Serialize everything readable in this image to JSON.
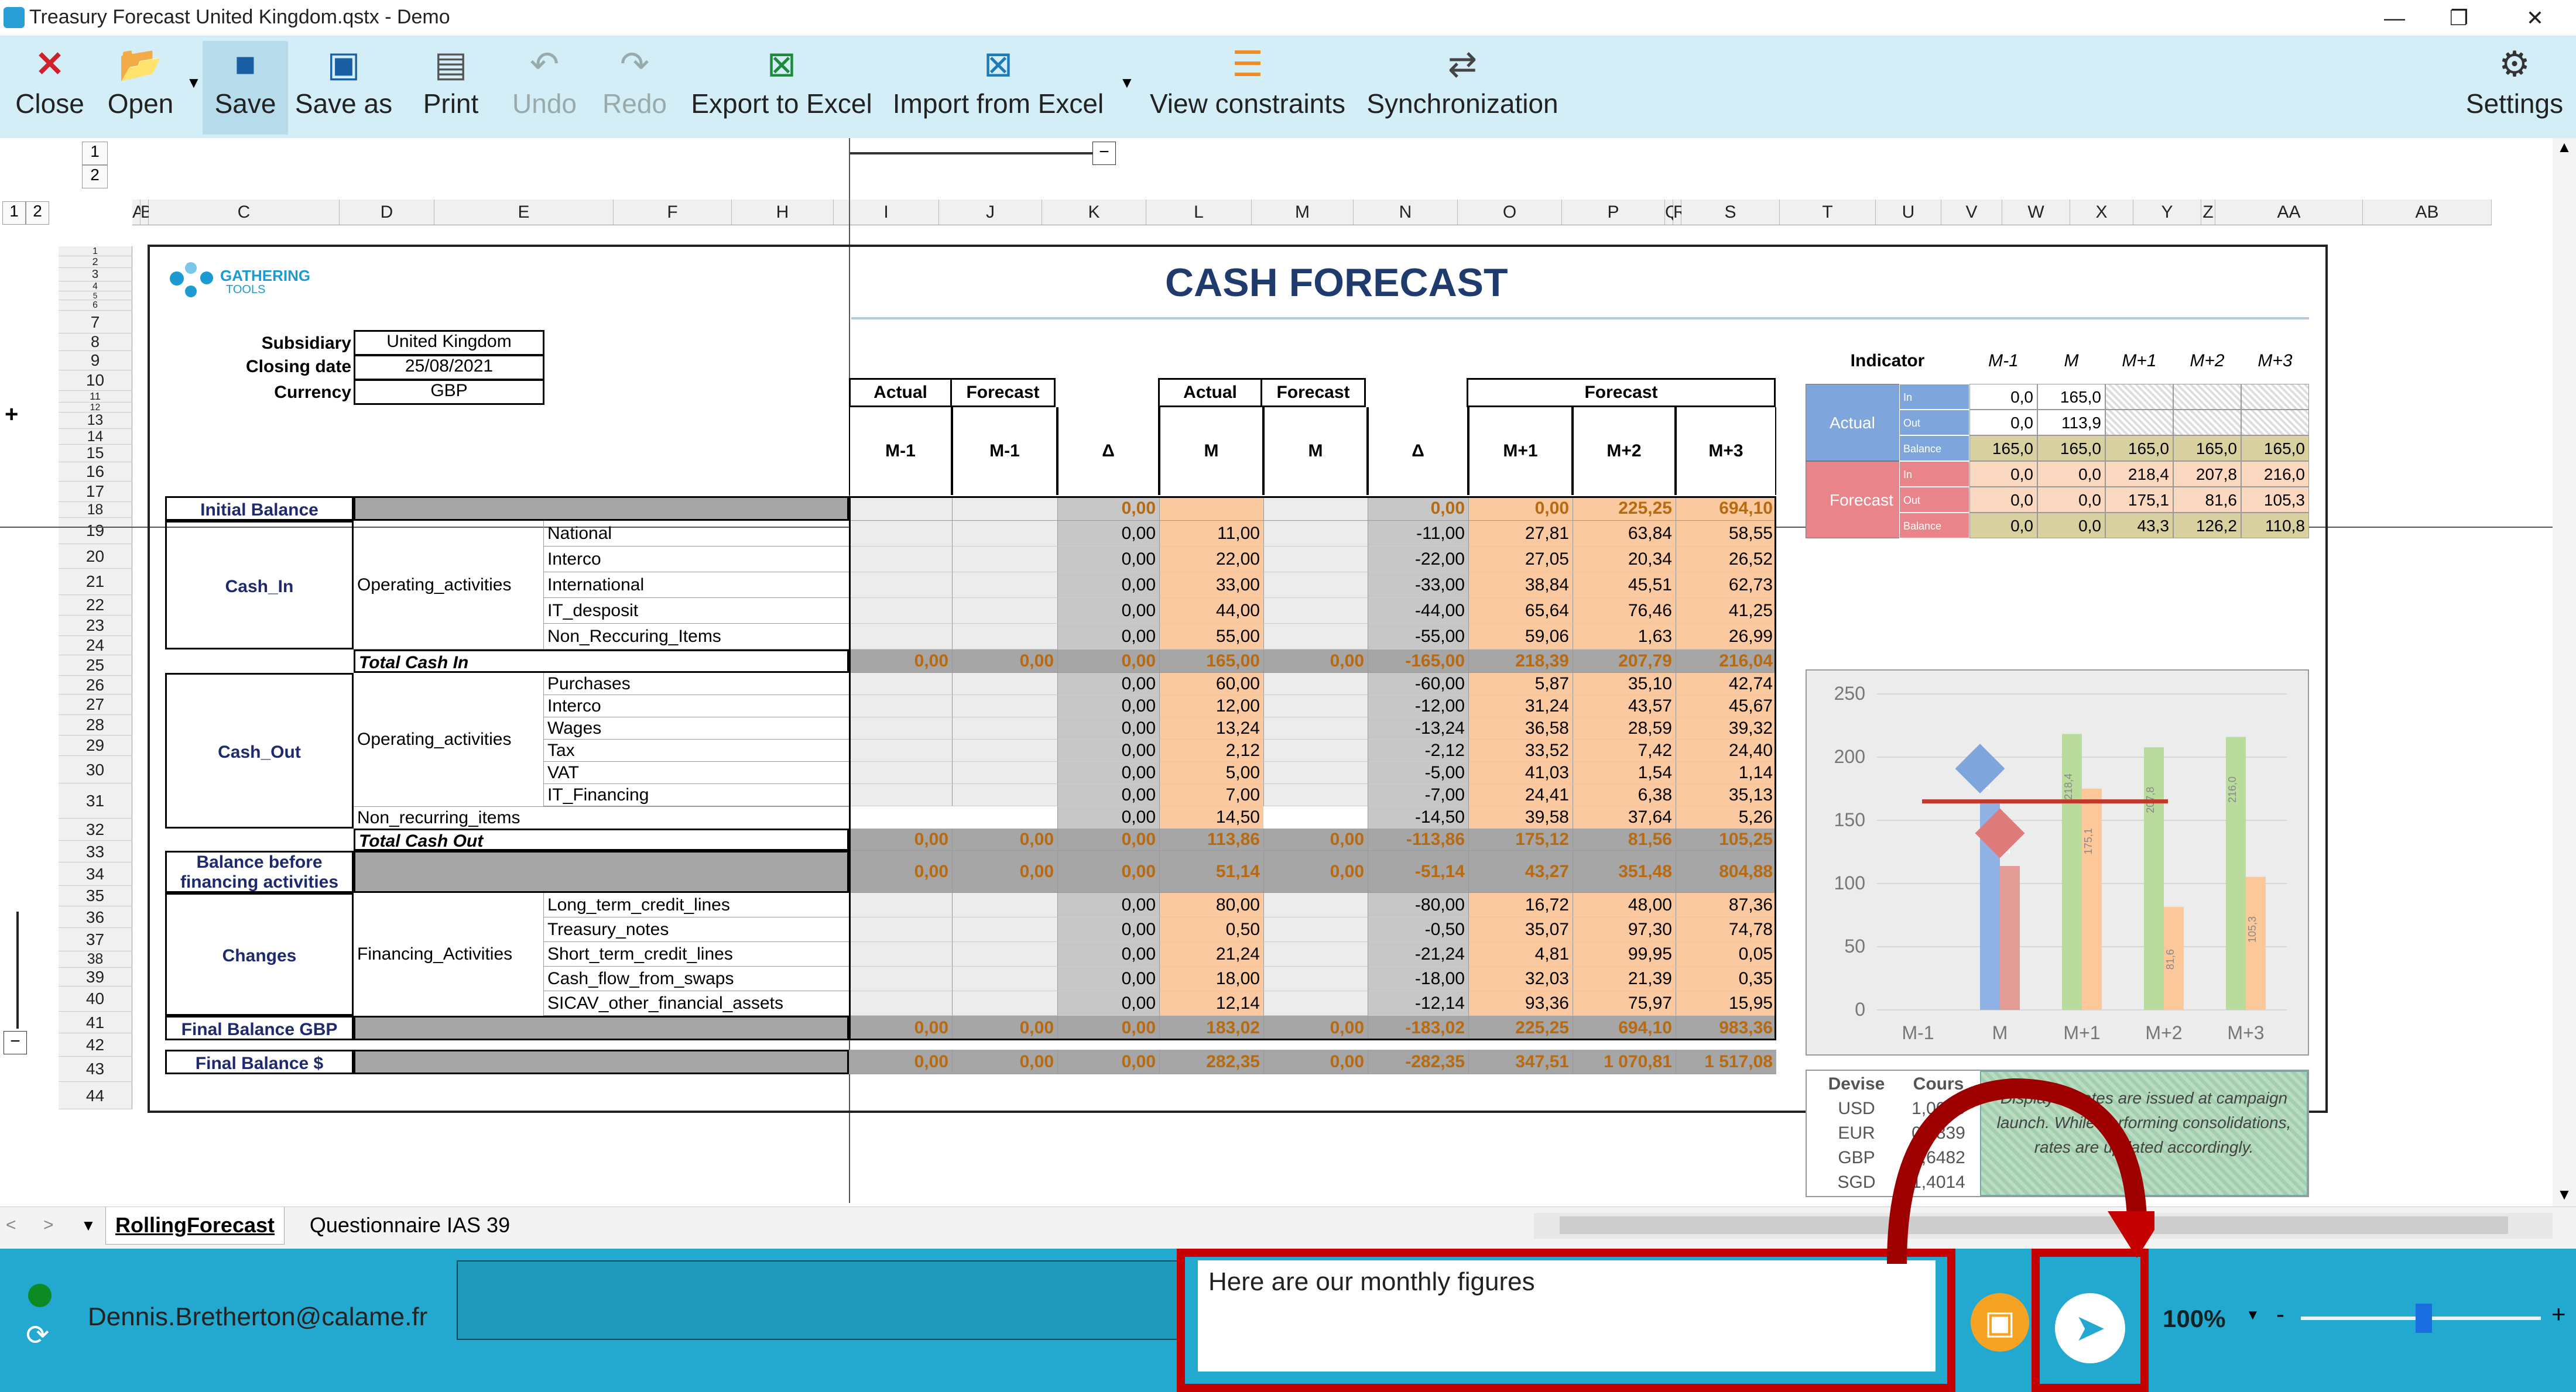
{
  "window": {
    "title": "Treasury Forecast United Kingdom.qstx - Demo",
    "minimize": "—",
    "restore": "❐",
    "close": "✕"
  },
  "toolbar": {
    "close": "Close",
    "open": "Open",
    "save": "Save",
    "save_as": "Save as",
    "print": "Print",
    "undo": "Undo",
    "redo": "Redo",
    "export_excel": "Export to Excel",
    "import_excel": "Import from Excel",
    "view_constraints": "View constraints",
    "synchronization": "Synchronization",
    "settings": "Settings"
  },
  "outline": {
    "levels": [
      "1",
      "2"
    ],
    "row_levels": [
      "1",
      "2"
    ],
    "expand": "+",
    "collapse": "−"
  },
  "columns": [
    "A",
    "B",
    "C",
    "D",
    "E",
    "F",
    "H",
    "I",
    "J",
    "K",
    "L",
    "M",
    "N",
    "O",
    "P",
    "Q",
    "R",
    "S",
    "T",
    "U",
    "V",
    "W",
    "X",
    "Y",
    "Z",
    "AA",
    "AB"
  ],
  "rows": [
    "1",
    "2",
    "3",
    "4",
    "5",
    "6",
    "7",
    "8",
    "9",
    "10",
    "11",
    "12",
    "13",
    "14",
    "15",
    "16",
    "17",
    "18",
    "19",
    "20",
    "21",
    "22",
    "23",
    "24",
    "25",
    "26",
    "27",
    "28",
    "29",
    "30",
    "31",
    "32",
    "33",
    "34",
    "35",
    "36",
    "37",
    "38",
    "39",
    "40",
    "41",
    "42",
    "43",
    "44"
  ],
  "sheet": {
    "logo_top": "GATHERING",
    "logo_bottom": "TOOLS",
    "title": "CASH FORECAST",
    "subsidiary_label": "Subsidiary",
    "subsidiary": "United Kingdom",
    "closing_label": "Closing date",
    "closing": "25/08/2021",
    "currency_label": "Currency",
    "currency": "GBP",
    "hdr_actual": "Actual",
    "hdr_forecast": "Forecast",
    "sub": [
      "M-1",
      "M-1",
      "Δ",
      "M",
      "M",
      "Δ",
      "M+1",
      "M+2",
      "M+3"
    ],
    "initial_balance": "Initial Balance",
    "initial_values": [
      "",
      "",
      "0,00",
      "",
      "",
      "0,00",
      "0,00",
      "225,25",
      "694,10"
    ],
    "cash_in": "Cash_In",
    "operating": "Operating_activities",
    "operating2": "Operating_activities",
    "cash_in_rows": [
      {
        "label": "National",
        "v": [
          "0,00",
          "11,00",
          "-11,00",
          "27,81",
          "63,84",
          "58,55"
        ]
      },
      {
        "label": "Interco",
        "v": [
          "0,00",
          "22,00",
          "-22,00",
          "27,05",
          "20,34",
          "26,52"
        ]
      },
      {
        "label": "International",
        "v": [
          "0,00",
          "33,00",
          "-33,00",
          "38,84",
          "45,51",
          "62,73"
        ]
      },
      {
        "label": "IT_desposit",
        "v": [
          "0,00",
          "44,00",
          "-44,00",
          "65,64",
          "76,46",
          "41,25"
        ]
      },
      {
        "label": "Non_Reccuring_Items",
        "v": [
          "0,00",
          "55,00",
          "-55,00",
          "59,06",
          "1,63",
          "26,99"
        ]
      }
    ],
    "total_in_label": "Total Cash In",
    "total_in": [
      "0,00",
      "0,00",
      "0,00",
      "165,00",
      "0,00",
      "-165,00",
      "218,39",
      "207,79",
      "216,04"
    ],
    "cash_out": "Cash_Out",
    "cash_out_rows": [
      {
        "label": "Purchases",
        "v": [
          "0,00",
          "60,00",
          "-60,00",
          "5,87",
          "35,10",
          "42,74"
        ]
      },
      {
        "label": "Interco",
        "v": [
          "0,00",
          "12,00",
          "-12,00",
          "31,24",
          "43,57",
          "45,67"
        ]
      },
      {
        "label": "Wages",
        "v": [
          "0,00",
          "13,24",
          "-13,24",
          "36,58",
          "28,59",
          "39,32"
        ]
      },
      {
        "label": "Tax",
        "v": [
          "0,00",
          "2,12",
          "-2,12",
          "33,52",
          "7,42",
          "24,40"
        ]
      },
      {
        "label": "VAT",
        "v": [
          "0,00",
          "5,00",
          "-5,00",
          "41,03",
          "1,54",
          "1,14"
        ]
      },
      {
        "label": "IT_Financing",
        "v": [
          "0,00",
          "7,00",
          "-7,00",
          "24,41",
          "6,38",
          "35,13"
        ]
      }
    ],
    "non_recurring_label": "Non_recurring_items",
    "non_recurring": [
      "0,00",
      "14,50",
      "-14,50",
      "39,58",
      "37,64",
      "5,26"
    ],
    "total_out_label": "Total Cash Out",
    "total_out": [
      "0,00",
      "0,00",
      "0,00",
      "113,86",
      "0,00",
      "-113,86",
      "175,12",
      "81,56",
      "105,25"
    ],
    "balance_before_1": "Balance before",
    "balance_before_2": "financing activities",
    "balance_before": [
      "0,00",
      "0,00",
      "0,00",
      "51,14",
      "0,00",
      "-51,14",
      "43,27",
      "351,48",
      "804,88"
    ],
    "changes": "Changes",
    "financing": "Financing_Activities",
    "changes_rows": [
      {
        "label": "Long_term_credit_lines",
        "v": [
          "0,00",
          "80,00",
          "-80,00",
          "16,72",
          "48,00",
          "87,36"
        ]
      },
      {
        "label": "Treasury_notes",
        "v": [
          "0,00",
          "0,50",
          "-0,50",
          "35,07",
          "97,30",
          "74,78"
        ]
      },
      {
        "label": "Short_term_credit_lines",
        "v": [
          "0,00",
          "21,24",
          "-21,24",
          "4,81",
          "99,95",
          "0,05"
        ]
      },
      {
        "label": "Cash_flow_from_swaps",
        "v": [
          "0,00",
          "18,00",
          "-18,00",
          "32,03",
          "21,39",
          "0,35"
        ]
      },
      {
        "label": "SICAV_other_financial_assets",
        "v": [
          "0,00",
          "12,14",
          "-12,14",
          "93,36",
          "75,97",
          "15,95"
        ]
      }
    ],
    "final_gbp_label": "Final Balance GBP",
    "final_gbp": [
      "0,00",
      "0,00",
      "0,00",
      "183,02",
      "0,00",
      "-183,02",
      "225,25",
      "694,10",
      "983,36"
    ],
    "final_usd_label": "Final Balance $",
    "final_usd": [
      "0,00",
      "0,00",
      "0,00",
      "282,35",
      "0,00",
      "-282,35",
      "347,51",
      "1 070,81",
      "1 517,08"
    ]
  },
  "indicator": {
    "title": "Indicator",
    "cols": [
      "M-1",
      "M",
      "M+1",
      "M+2",
      "M+3"
    ],
    "actual": "Actual",
    "forecast": "Forecast",
    "in": "In",
    "out": "Out",
    "balance": "Balance",
    "actual_rows": [
      [
        "0,0",
        "165,0",
        "",
        "",
        ""
      ],
      [
        "0,0",
        "113,9",
        "",
        "",
        ""
      ],
      [
        "165,0",
        "165,0",
        "165,0",
        "165,0",
        "165,0"
      ]
    ],
    "forecast_rows": [
      [
        "0,0",
        "0,0",
        "218,4",
        "207,8",
        "216,0"
      ],
      [
        "0,0",
        "0,0",
        "175,1",
        "81,6",
        "105,3"
      ],
      [
        "0,0",
        "0,0",
        "43,3",
        "126,2",
        "110,8"
      ]
    ]
  },
  "chart_data": {
    "type": "bar",
    "categories": [
      "M-1",
      "M",
      "M+1",
      "M+2",
      "M+3"
    ],
    "series": [
      {
        "values": [
          0,
          165.0,
          0,
          0,
          0
        ],
        "color": "#8fb1e4"
      },
      {
        "values": [
          0,
          113.9,
          0,
          0,
          0
        ],
        "color": "#e39b96"
      },
      {
        "values": [
          0,
          0,
          218.4,
          207.8,
          216.0
        ],
        "color": "#b9dc9c"
      },
      {
        "values": [
          0,
          0,
          175.1,
          81.6,
          105.3
        ],
        "color": "#fcc89a"
      }
    ],
    "reference_line": 165,
    "labels": {
      "M": [
        "165,0",
        "113,9"
      ],
      "M+1": [
        "218,4",
        "175,1"
      ],
      "M+2": [
        "207,8",
        "81,6"
      ],
      "M+3": [
        "216,0",
        "105,3"
      ]
    },
    "ylim": [
      0,
      250
    ],
    "yticks": [
      "0",
      "50",
      "100",
      "150",
      "200",
      "250"
    ]
  },
  "rates": {
    "hdr_devise": "Devise",
    "hdr_cours": "Cours",
    "rows": [
      [
        "USD",
        "1,0000"
      ],
      [
        "EUR",
        "0,8839"
      ],
      [
        "GBP",
        "0,6482"
      ],
      [
        "SGD",
        "1,4014"
      ]
    ],
    "note": "Displayed rates are issued at campaign launch. While performing consolidations, rates are updated accordingly."
  },
  "tabs": [
    "RollingForecast",
    "Questionnaire IAS 39"
  ],
  "footer": {
    "user": "Dennis.Bretherton@calame.fr",
    "message": "Here are our monthly figures",
    "zoom": "100%",
    "zoom_minus": "-",
    "zoom_plus": "+"
  },
  "colors": {
    "toolbar": "#d4eef7",
    "footer": "#23a8cf",
    "highlight": "#c50000",
    "navy": "#1f2a6e"
  }
}
